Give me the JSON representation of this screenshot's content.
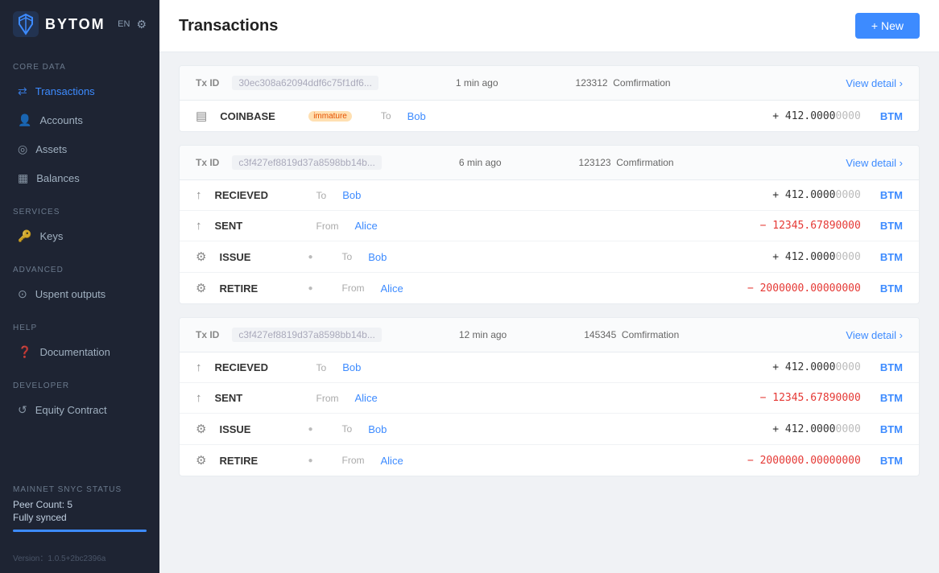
{
  "app": {
    "logo_text": "BYTOM",
    "lang": "EN",
    "version": "Version：1.0.5+2bc2396a"
  },
  "sidebar": {
    "sections": [
      {
        "label": "CORE DATA",
        "items": [
          {
            "id": "transactions",
            "label": "Transactions",
            "icon": "⇄",
            "active": true
          },
          {
            "id": "accounts",
            "label": "Accounts",
            "icon": "👤",
            "active": false
          },
          {
            "id": "assets",
            "label": "Assets",
            "icon": "◎",
            "active": false
          },
          {
            "id": "balances",
            "label": "Balances",
            "icon": "▦",
            "active": false
          }
        ]
      },
      {
        "label": "SERVICES",
        "items": [
          {
            "id": "keys",
            "label": "Keys",
            "icon": "🔑",
            "active": false
          }
        ]
      },
      {
        "label": "ADVANCED",
        "items": [
          {
            "id": "unspent",
            "label": "Uspent outputs",
            "icon": "⊙",
            "active": false
          }
        ]
      },
      {
        "label": "HELP",
        "items": [
          {
            "id": "documentation",
            "label": "Documentation",
            "icon": "❓",
            "active": false
          }
        ]
      },
      {
        "label": "DEVELOPER",
        "items": [
          {
            "id": "equity",
            "label": "Equity Contract",
            "icon": "↺",
            "active": false
          }
        ]
      }
    ],
    "sync": {
      "label": "MAINNET SNYC STATUS",
      "peer_count": "Peer Count: 5",
      "status": "Fully synced"
    }
  },
  "header": {
    "title": "Transactions",
    "new_button": "+ New"
  },
  "transactions": [
    {
      "tx_id": "30ec308a62094ddf6c75f1df6...",
      "time": "1 min ago",
      "confirmations": "123312",
      "confirmation_label": "Comfirmation",
      "view_detail": "View detail",
      "rows": [
        {
          "type": "COINBASE",
          "badge": "immature",
          "direction": "To",
          "party": "Bob",
          "sign": "+",
          "amount_main": " 412.0000",
          "amount_dim": "0000",
          "currency": "BTM",
          "icon": "▤"
        }
      ]
    },
    {
      "tx_id": "c3f427ef8819d37a8598bb14b...",
      "time": "6 min ago",
      "confirmations": "123123",
      "confirmation_label": "Comfirmation",
      "view_detail": "View detail",
      "rows": [
        {
          "type": "RECIEVED",
          "badge": "",
          "direction": "To",
          "party": "Bob",
          "sign": "+",
          "amount_main": " 412.0000",
          "amount_dim": "0000",
          "currency": "BTM",
          "icon": "↑"
        },
        {
          "type": "SENT",
          "badge": "",
          "direction": "From",
          "party": "Alice",
          "sign": "−",
          "amount_main": " 12345.6789",
          "amount_dim": "0000",
          "currency": "BTM",
          "icon": "↑",
          "negative": true
        },
        {
          "type": "ISSUE",
          "badge": "●",
          "direction": "To",
          "party": "Bob",
          "sign": "+",
          "amount_main": " 412.0000",
          "amount_dim": "0000",
          "currency": "BTM",
          "icon": "⚙"
        },
        {
          "type": "RETIRE",
          "badge": "●",
          "direction": "From",
          "party": "Alice",
          "sign": "−",
          "amount_main": " 2000000.0000",
          "amount_dim": "0000",
          "currency": "BTM",
          "icon": "⚙",
          "negative": true
        }
      ]
    },
    {
      "tx_id": "c3f427ef8819d37a8598bb14b...",
      "time": "12 min ago",
      "confirmations": "145345",
      "confirmation_label": "Comfirmation",
      "view_detail": "View detail",
      "rows": [
        {
          "type": "RECIEVED",
          "badge": "",
          "direction": "To",
          "party": "Bob",
          "sign": "+",
          "amount_main": " 412.0000",
          "amount_dim": "0000",
          "currency": "BTM",
          "icon": "↑"
        },
        {
          "type": "SENT",
          "badge": "",
          "direction": "From",
          "party": "Alice",
          "sign": "−",
          "amount_main": " 12345.6789",
          "amount_dim": "0000",
          "currency": "BTM",
          "icon": "↑",
          "negative": true
        },
        {
          "type": "ISSUE",
          "badge": "●",
          "direction": "To",
          "party": "Bob",
          "sign": "+",
          "amount_main": " 412.0000",
          "amount_dim": "0000",
          "currency": "BTM",
          "icon": "⚙"
        },
        {
          "type": "RETIRE",
          "badge": "●",
          "direction": "From",
          "party": "Alice",
          "sign": "−",
          "amount_main": " 2000000.0000",
          "amount_dim": "0000",
          "currency": "BTM",
          "icon": "⚙",
          "negative": true
        }
      ]
    }
  ]
}
